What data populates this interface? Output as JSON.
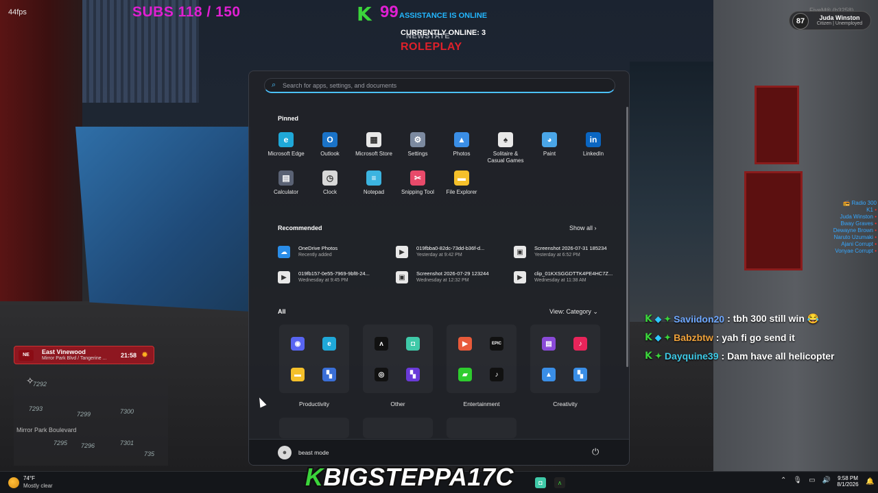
{
  "hud": {
    "fps": "44fps",
    "subs": "SUBS 118 / 150",
    "k_count": "99",
    "assistance": "ASSISTANCE IS ONLINE",
    "currently_online": "CURRENTLY ONLINE: 3",
    "server_name_top": "NEWSTATE",
    "server_name": "ROLEPLAY",
    "fivem": "FiveM® (b3258)",
    "player_level": "87",
    "player_name": "Juda Winston",
    "player_role": "Citizen | Unemployed",
    "radio": [
      "Radio 300",
      "K1",
      "Juda Winston",
      "Bway Graves",
      "Dewayne Brown",
      "Naruto Uzumaki",
      "Ajani Corrupt",
      "Vonyae Corrupt"
    ],
    "chat": [
      {
        "name": "Saviidon20",
        "text": ": tbh 300 still win 😂"
      },
      {
        "name": "Babzbtw",
        "text": ": yah fi go send it"
      },
      {
        "name": "Dayquine39",
        "text": ": Dam have all helicopter"
      }
    ],
    "location": {
      "flag": "NE",
      "street": "East Vinewood",
      "sub": "Mirror Park Blvd / Tangerine ...",
      "time": "21:58"
    },
    "minimap": {
      "street": "Mirror Park Boulevard",
      "numbers": [
        "7292",
        "7293",
        "7299",
        "7300",
        "7295",
        "7296",
        "7301",
        "735"
      ]
    },
    "streamer_k": "K",
    "streamer": "BIGSTEPPA17C"
  },
  "start_menu": {
    "search_placeholder": "Search for apps, settings, and documents",
    "pinned_title": "Pinned",
    "pinned": [
      {
        "label": "Microsoft Edge",
        "icon": "edge-icon",
        "glyph": "e",
        "color": "#1fa8d8"
      },
      {
        "label": "Outlook",
        "icon": "outlook-icon",
        "glyph": "O",
        "color": "#1a73c8"
      },
      {
        "label": "Microsoft Store",
        "icon": "store-icon",
        "glyph": "▦",
        "color": "#e8e8e8"
      },
      {
        "label": "Settings",
        "icon": "gear-icon",
        "glyph": "⚙",
        "color": "#7c8aa0"
      },
      {
        "label": "Photos",
        "icon": "photos-icon",
        "glyph": "▲",
        "color": "#3a8ee6"
      },
      {
        "label": "Solitaire &\nCasual Games",
        "icon": "solitaire-icon",
        "glyph": "♠",
        "color": "#e8e8e8"
      },
      {
        "label": "Paint",
        "icon": "paint-icon",
        "glyph": "◕",
        "color": "#4aa6e8"
      },
      {
        "label": "LinkedIn",
        "icon": "linkedin-icon",
        "glyph": "in",
        "color": "#0a66c2"
      },
      {
        "label": "Calculator",
        "icon": "calculator-icon",
        "glyph": "▤",
        "color": "#5a6274"
      },
      {
        "label": "Clock",
        "icon": "clock-icon",
        "glyph": "◷",
        "color": "#d8d8d8"
      },
      {
        "label": "Notepad",
        "icon": "notepad-icon",
        "glyph": "≡",
        "color": "#3cb4e0"
      },
      {
        "label": "Snipping Tool",
        "icon": "snipping-tool-icon",
        "glyph": "✂",
        "color": "#e84a6a"
      },
      {
        "label": "File Explorer",
        "icon": "folder-icon",
        "glyph": "▬",
        "color": "#f5c02a"
      }
    ],
    "recommended_title": "Recommended",
    "show_all": "Show all  ›",
    "recommended": [
      {
        "name": "OneDrive Photos",
        "sub": "Recently added",
        "icon": "onedrive-icon",
        "color": "#2a8de8",
        "glyph": "☁"
      },
      {
        "name": "019fbba0-82dc-73dd-b36f-d...",
        "sub": "Yesterday at 9:42 PM",
        "icon": "video-file-icon",
        "color": "#e8e8e8",
        "glyph": "▶"
      },
      {
        "name": "Screenshot 2026-07-31 185234",
        "sub": "Yesterday at 6:52 PM",
        "icon": "image-file-icon",
        "color": "#e8e8e8",
        "glyph": "▣"
      },
      {
        "name": "019fb157-0e55-7969-9bf8-24...",
        "sub": "Wednesday at 9:45 PM",
        "icon": "video-file-icon",
        "color": "#e8e8e8",
        "glyph": "▶"
      },
      {
        "name": "Screenshot 2026-07-29 123244",
        "sub": "Wednesday at 12:32 PM",
        "icon": "image-file-icon",
        "color": "#e8e8e8",
        "glyph": "▣"
      },
      {
        "name": "clip_01KXSGGDTTK4PE4HC7Z...",
        "sub": "Wednesday at 11:38 AM",
        "icon": "video-file-icon",
        "color": "#e8e8e8",
        "glyph": "▶"
      }
    ],
    "all_title": "All",
    "view_category": "View: Category  ⌄",
    "categories": [
      {
        "label": "Productivity",
        "icons": [
          {
            "name": "discord-icon",
            "glyph": "◉",
            "color": "#5865f2"
          },
          {
            "name": "edge-icon",
            "glyph": "e",
            "color": "#1fa8d8"
          },
          {
            "name": "folder-icon",
            "glyph": "▬",
            "color": "#f5c02a"
          },
          {
            "name": "mini-apps-icon",
            "glyph": "▚",
            "color": "#3a6fd8"
          }
        ]
      },
      {
        "label": "Other",
        "icons": [
          {
            "name": "nvidia-icon",
            "glyph": "ʌ",
            "color": "#111"
          },
          {
            "name": "game-bar-icon",
            "glyph": "◘",
            "color": "#3fc9a8"
          },
          {
            "name": "nvidia-app-icon",
            "glyph": "◎",
            "color": "#111"
          },
          {
            "name": "mini-apps-icon",
            "glyph": "▚",
            "color": "#6a3ad8"
          }
        ]
      },
      {
        "label": "Entertainment",
        "icons": [
          {
            "name": "media-player-icon",
            "glyph": "▶",
            "color": "#e85a3a"
          },
          {
            "name": "epic-games-icon",
            "glyph": "EPIC",
            "color": "#111"
          },
          {
            "name": "xbox-game-pass-icon",
            "glyph": "▰",
            "color": "#2ecc2e"
          },
          {
            "name": "tiktok-icon",
            "glyph": "♪",
            "color": "#111"
          }
        ]
      },
      {
        "label": "Creativity",
        "icons": [
          {
            "name": "clipchamp-icon",
            "glyph": "▤",
            "color": "#8a4ad8"
          },
          {
            "name": "tiktok-icon",
            "glyph": "♪",
            "color": "#e8245a"
          },
          {
            "name": "photos-icon",
            "glyph": "▲",
            "color": "#3a8ee6"
          },
          {
            "name": "mini-apps-icon",
            "glyph": "▚",
            "color": "#3a8ee6"
          }
        ]
      }
    ],
    "user_name": "beast mode"
  },
  "taskbar": {
    "temp": "74°F",
    "condition": "Mostly clear",
    "time": "9:58 PM",
    "date": "8/1/2026"
  }
}
